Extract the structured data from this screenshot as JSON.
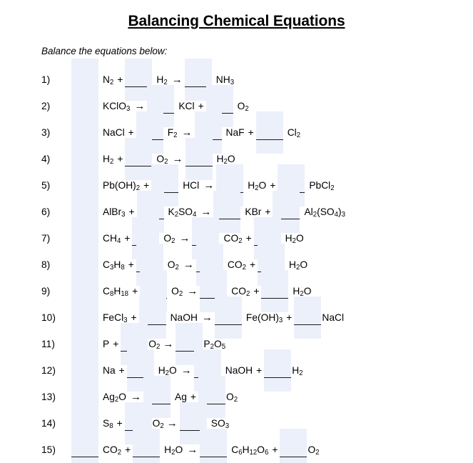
{
  "title": "Balancing Chemical Equations",
  "instruction": "Balance the equations below:",
  "colors": {
    "blank_fill": "#ecf0fb",
    "blank_rule": "#1a1a1a",
    "text": "#000000",
    "page_background": "#ffffff"
  },
  "symbols": {
    "plus": "+",
    "arrow": "→",
    "blank_placeholder": "____"
  },
  "equations": [
    {
      "number": "1)",
      "equation_text": "____ N2 + ____ H2 → ____ NH3",
      "reactants": [
        "N2",
        "H2"
      ],
      "products": [
        "NH3"
      ],
      "tokens": [
        {
          "type": "blank"
        },
        {
          "type": "formula",
          "base": "N",
          "sub": "2"
        },
        {
          "type": "op",
          "text": "+"
        },
        {
          "type": "blank"
        },
        {
          "type": "formula",
          "base": "H",
          "sub": "2"
        },
        {
          "type": "arrow",
          "text": "→"
        },
        {
          "type": "blank"
        },
        {
          "type": "formula",
          "base": "NH",
          "sub": "3"
        }
      ]
    },
    {
      "number": "2)",
      "equation_text": "____ KClO3 → ____ KCl + ____ O2",
      "reactants": [
        "KClO3"
      ],
      "products": [
        "KCl",
        "O2"
      ],
      "tokens": [
        {
          "type": "blank"
        },
        {
          "type": "formula",
          "base": "KClO",
          "sub": "3"
        },
        {
          "type": "arrow",
          "text": "→"
        },
        {
          "type": "blank"
        },
        {
          "type": "formula",
          "base": "KCl",
          "sub": ""
        },
        {
          "type": "op",
          "text": "+"
        },
        {
          "type": "blank"
        },
        {
          "type": "formula",
          "base": "O",
          "sub": "2"
        }
      ]
    },
    {
      "number": "3)",
      "equation_text": "____ NaCl + ____ F2 → ____ NaF + ____ Cl2",
      "reactants": [
        "NaCl",
        "F2"
      ],
      "products": [
        "NaF",
        "Cl2"
      ],
      "tokens": [
        {
          "type": "blank"
        },
        {
          "type": "formula",
          "base": "NaCl",
          "sub": ""
        },
        {
          "type": "op",
          "text": "+"
        },
        {
          "type": "blank"
        },
        {
          "type": "formula",
          "base": "F",
          "sub": "2"
        },
        {
          "type": "arrow",
          "text": "→"
        },
        {
          "type": "blank"
        },
        {
          "type": "formula",
          "base": "NaF",
          "sub": ""
        },
        {
          "type": "op",
          "text": "+"
        },
        {
          "type": "blank"
        },
        {
          "type": "formula",
          "base": "Cl",
          "sub": "2"
        }
      ]
    },
    {
      "number": "4)",
      "equation_text": "____ H2 + ____ O2 → ____ H2O",
      "reactants": [
        "H2",
        "O2"
      ],
      "products": [
        "H2O"
      ],
      "tokens": [
        {
          "type": "blank"
        },
        {
          "type": "formula",
          "base": "H",
          "sub": "2"
        },
        {
          "type": "op",
          "text": "+"
        },
        {
          "type": "blank"
        },
        {
          "type": "formula",
          "base": "O",
          "sub": "2"
        },
        {
          "type": "arrow",
          "text": "→"
        },
        {
          "type": "blank"
        },
        {
          "type": "formula",
          "base": "H",
          "sub": "2",
          "tail": "O"
        }
      ]
    },
    {
      "number": "5)",
      "equation_text": "____ Pb(OH)2 + ____ HCl → ____ H2O + ____ PbCl2",
      "reactants": [
        "Pb(OH)2",
        "HCl"
      ],
      "products": [
        "H2O",
        "PbCl2"
      ],
      "tokens": [
        {
          "type": "blank"
        },
        {
          "type": "formula",
          "base": "Pb(OH)",
          "sub": "2"
        },
        {
          "type": "op",
          "text": "+"
        },
        {
          "type": "blank"
        },
        {
          "type": "formula",
          "base": "HCl",
          "sub": ""
        },
        {
          "type": "arrow",
          "text": "→"
        },
        {
          "type": "blank"
        },
        {
          "type": "formula",
          "base": "H",
          "sub": "2",
          "tail": "O"
        },
        {
          "type": "op",
          "text": "+"
        },
        {
          "type": "blank"
        },
        {
          "type": "formula",
          "base": "PbCl",
          "sub": "2"
        }
      ]
    },
    {
      "number": "6)",
      "equation_text": "____ AlBr3 + ____ K2SO4 → ____ KBr + ____ Al2(SO4)3",
      "reactants": [
        "AlBr3",
        "K2SO4"
      ],
      "products": [
        "KBr",
        "Al2(SO4)3"
      ],
      "tokens": [
        {
          "type": "blank"
        },
        {
          "type": "formula",
          "base": "AlBr",
          "sub": "3"
        },
        {
          "type": "op",
          "text": "+"
        },
        {
          "type": "blank"
        },
        {
          "type": "formula",
          "base": "K",
          "sub": "2",
          "tail": "SO",
          "sub2": "4"
        },
        {
          "type": "arrow",
          "text": "→"
        },
        {
          "type": "blank"
        },
        {
          "type": "formula",
          "base": "KBr",
          "sub": ""
        },
        {
          "type": "op",
          "text": "+"
        },
        {
          "type": "blank"
        },
        {
          "type": "formula",
          "base": "Al",
          "sub": "2",
          "tail": "(SO",
          "sub2": "4",
          "tail2": ")",
          "sub3": "3"
        }
      ]
    },
    {
      "number": "7)",
      "equation_text": "____ CH4 + ____ O2 → ____ CO2 + ____ H2O",
      "reactants": [
        "CH4",
        "O2"
      ],
      "products": [
        "CO2",
        "H2O"
      ],
      "tokens": [
        {
          "type": "blank"
        },
        {
          "type": "formula",
          "base": "CH",
          "sub": "4"
        },
        {
          "type": "op",
          "text": "+"
        },
        {
          "type": "blank"
        },
        {
          "type": "formula",
          "base": "O",
          "sub": "2"
        },
        {
          "type": "arrow",
          "text": "→"
        },
        {
          "type": "blank"
        },
        {
          "type": "formula",
          "base": "CO",
          "sub": "2"
        },
        {
          "type": "op",
          "text": "+"
        },
        {
          "type": "blank"
        },
        {
          "type": "formula",
          "base": "H",
          "sub": "2",
          "tail": "O"
        }
      ]
    },
    {
      "number": "8)",
      "equation_text": "____ C3H8 + ____ O2 → ____ CO2 + ____ H2O",
      "reactants": [
        "C3H8",
        "O2"
      ],
      "products": [
        "CO2",
        "H2O"
      ],
      "tokens": [
        {
          "type": "blank"
        },
        {
          "type": "formula",
          "base": "C",
          "sub": "3",
          "tail": "H",
          "sub2": "8"
        },
        {
          "type": "op",
          "text": "+"
        },
        {
          "type": "blank"
        },
        {
          "type": "formula",
          "base": "O",
          "sub": "2"
        },
        {
          "type": "arrow",
          "text": "→"
        },
        {
          "type": "blank"
        },
        {
          "type": "formula",
          "base": "CO",
          "sub": "2"
        },
        {
          "type": "op",
          "text": "+"
        },
        {
          "type": "blank"
        },
        {
          "type": "formula",
          "base": "H",
          "sub": "2",
          "tail": "O"
        }
      ]
    },
    {
      "number": "9)",
      "equation_text": "____ C8H18 + ____ O2 → ____ CO2 + ____ H2O",
      "reactants": [
        "C8H18",
        "O2"
      ],
      "products": [
        "CO2",
        "H2O"
      ],
      "tokens": [
        {
          "type": "blank"
        },
        {
          "type": "formula",
          "base": "C",
          "sub": "8",
          "tail": "H",
          "sub2": "18"
        },
        {
          "type": "op",
          "text": "+"
        },
        {
          "type": "blank"
        },
        {
          "type": "formula",
          "base": "O",
          "sub": "2"
        },
        {
          "type": "arrow",
          "text": "→"
        },
        {
          "type": "blank"
        },
        {
          "type": "formula",
          "base": "CO",
          "sub": "2"
        },
        {
          "type": "op",
          "text": "+"
        },
        {
          "type": "blank"
        },
        {
          "type": "formula",
          "base": "H",
          "sub": "2",
          "tail": "O"
        }
      ]
    },
    {
      "number": "10)",
      "equation_text": "____ FeCl3 + ____ NaOH → ____ Fe(OH)3 + ____NaCl",
      "reactants": [
        "FeCl3",
        "NaOH"
      ],
      "products": [
        "Fe(OH)3",
        "NaCl"
      ],
      "tokens": [
        {
          "type": "blank"
        },
        {
          "type": "formula",
          "base": "FeCl",
          "sub": "3"
        },
        {
          "type": "op",
          "text": "+"
        },
        {
          "type": "blank"
        },
        {
          "type": "formula",
          "base": "NaOH",
          "sub": ""
        },
        {
          "type": "arrow",
          "text": "→"
        },
        {
          "type": "blank"
        },
        {
          "type": "formula",
          "base": "Fe(OH)",
          "sub": "3"
        },
        {
          "type": "op",
          "text": "+"
        },
        {
          "type": "blank"
        },
        {
          "type": "formula",
          "base": "NaCl",
          "sub": "",
          "tight": true
        }
      ]
    },
    {
      "number": "11)",
      "equation_text": "____ P + ____O2 → ____P2O5",
      "reactants": [
        "P",
        "O2"
      ],
      "products": [
        "P2O5"
      ],
      "tokens": [
        {
          "type": "blank"
        },
        {
          "type": "formula",
          "base": "P",
          "sub": ""
        },
        {
          "type": "op",
          "text": "+"
        },
        {
          "type": "blank"
        },
        {
          "type": "formula",
          "base": "O",
          "sub": "2",
          "tight": true
        },
        {
          "type": "arrow",
          "text": "→"
        },
        {
          "type": "blank"
        },
        {
          "type": "formula",
          "base": "P",
          "sub": "2",
          "tail": "O",
          "sub2": "5",
          "tight": true
        }
      ]
    },
    {
      "number": "12)",
      "equation_text": "____ Na + ____ H2O → ____ NaOH + ____H2",
      "reactants": [
        "Na",
        "H2O"
      ],
      "products": [
        "NaOH",
        "H2"
      ],
      "tokens": [
        {
          "type": "blank"
        },
        {
          "type": "formula",
          "base": "Na",
          "sub": ""
        },
        {
          "type": "op",
          "text": "+"
        },
        {
          "type": "blank"
        },
        {
          "type": "formula",
          "base": "H",
          "sub": "2",
          "tail": "O"
        },
        {
          "type": "arrow",
          "text": "→"
        },
        {
          "type": "blank"
        },
        {
          "type": "formula",
          "base": "NaOH",
          "sub": ""
        },
        {
          "type": "op",
          "text": "+"
        },
        {
          "type": "blank"
        },
        {
          "type": "formula",
          "base": "H",
          "sub": "2",
          "tight": true
        }
      ]
    },
    {
      "number": "13)",
      "equation_text": "____ Ag2O → ____ Ag + ____O2",
      "reactants": [
        "Ag2O"
      ],
      "products": [
        "Ag",
        "O2"
      ],
      "tokens": [
        {
          "type": "blank"
        },
        {
          "type": "formula",
          "base": "Ag",
          "sub": "2",
          "tail": "O"
        },
        {
          "type": "arrow",
          "text": "→"
        },
        {
          "type": "blank"
        },
        {
          "type": "formula",
          "base": "Ag",
          "sub": ""
        },
        {
          "type": "op",
          "text": "+"
        },
        {
          "type": "blank"
        },
        {
          "type": "formula",
          "base": "O",
          "sub": "2",
          "tight": true
        }
      ]
    },
    {
      "number": "14)",
      "equation_text": "____ S8 + ____O2 → ____ SO3",
      "reactants": [
        "S8",
        "O2"
      ],
      "products": [
        "SO3"
      ],
      "tokens": [
        {
          "type": "blank"
        },
        {
          "type": "formula",
          "base": "S",
          "sub": "8"
        },
        {
          "type": "op",
          "text": "+"
        },
        {
          "type": "blank"
        },
        {
          "type": "formula",
          "base": "O",
          "sub": "2",
          "tight": true
        },
        {
          "type": "arrow",
          "text": "→"
        },
        {
          "type": "blank"
        },
        {
          "type": "formula",
          "base": "SO",
          "sub": "3"
        }
      ]
    },
    {
      "number": "15)",
      "equation_text": "____ CO2 + ____ H2O → ____ C6H12O6 + ____O2",
      "reactants": [
        "CO2",
        "H2O"
      ],
      "products": [
        "C6H12O6",
        "O2"
      ],
      "tokens": [
        {
          "type": "blank"
        },
        {
          "type": "formula",
          "base": "CO",
          "sub": "2"
        },
        {
          "type": "op",
          "text": "+"
        },
        {
          "type": "blank"
        },
        {
          "type": "formula",
          "base": "H",
          "sub": "2",
          "tail": "O"
        },
        {
          "type": "arrow",
          "text": "→"
        },
        {
          "type": "blank"
        },
        {
          "type": "formula",
          "base": "C",
          "sub": "6",
          "tail": "H",
          "sub2": "12",
          "tail2": "O",
          "sub3": "6"
        },
        {
          "type": "op",
          "text": "+"
        },
        {
          "type": "blank"
        },
        {
          "type": "formula",
          "base": "O",
          "sub": "2",
          "tight": true
        }
      ]
    }
  ]
}
